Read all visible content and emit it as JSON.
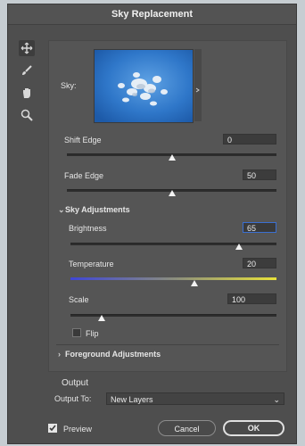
{
  "dialog": {
    "title": "Sky Replacement"
  },
  "tools": [
    {
      "name": "move-tool",
      "icon": "move-icon"
    },
    {
      "name": "sky-brush-tool",
      "icon": "brush-icon"
    },
    {
      "name": "hand-tool",
      "icon": "hand-icon"
    },
    {
      "name": "zoom-tool",
      "icon": "zoom-icon"
    }
  ],
  "sky": {
    "label": "Sky:"
  },
  "shift_edge": {
    "label": "Shift Edge",
    "value": "0",
    "slider_fraction": 0.5
  },
  "fade_edge": {
    "label": "Fade Edge",
    "value": "50",
    "slider_fraction": 0.5
  },
  "sky_adjustments": {
    "label": "Sky Adjustments",
    "brightness": {
      "label": "Brightness",
      "value": "65",
      "slider_fraction": 0.82
    },
    "temperature": {
      "label": "Temperature",
      "value": "20",
      "slider_fraction": 0.6
    },
    "scale": {
      "label": "Scale",
      "value": "100",
      "slider_fraction": 0.15
    },
    "flip": {
      "label": "Flip",
      "checked": false
    }
  },
  "foreground_adjustments": {
    "label": "Foreground Adjustments"
  },
  "output": {
    "heading": "Output",
    "output_to_label": "Output To:",
    "output_to_value": "New Layers"
  },
  "footer": {
    "preview_label": "Preview",
    "preview_checked": true,
    "cancel_label": "Cancel",
    "ok_label": "OK"
  },
  "colors": {
    "accent": "#3b6fd1",
    "temp_cool": "#3f46d6",
    "temp_warm": "#e8e23a"
  }
}
